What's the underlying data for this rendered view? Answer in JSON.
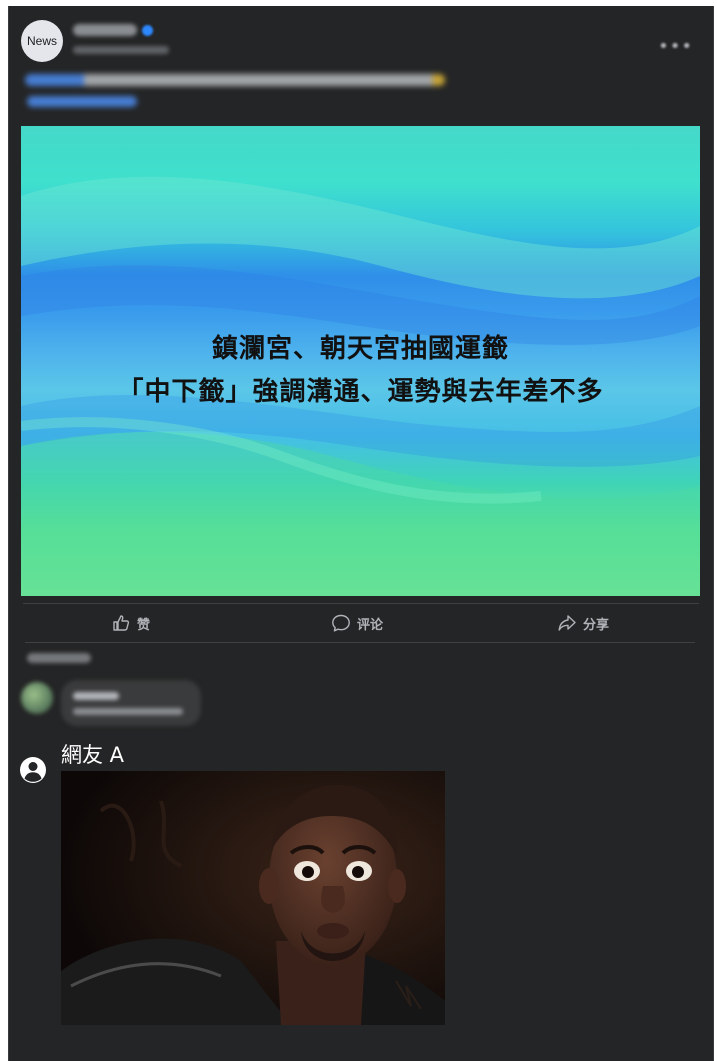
{
  "post": {
    "avatar_text": "News",
    "headline_line1": "鎮瀾宮、朝天宮抽國運籤",
    "headline_line2": "「中下籤」強調溝通、運勢與去年差不多"
  },
  "actions": {
    "like_label": "赞",
    "comment_label": "评论",
    "share_label": "分享"
  },
  "reply": {
    "user_name": "網友 A"
  },
  "icons": {
    "like": "thumbs-up-icon",
    "comment": "speech-bubble-icon",
    "share": "share-arrow-icon",
    "user": "user-circle-icon"
  },
  "colors": {
    "background": "#242526",
    "text_secondary": "#b0b3b8",
    "divider": "#3e4042"
  }
}
